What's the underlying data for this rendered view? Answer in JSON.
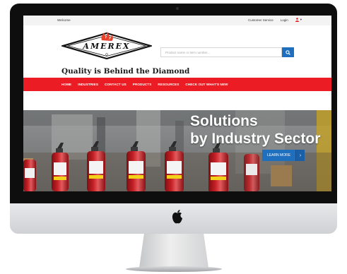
{
  "topbar": {
    "welcome": "Welcome",
    "customer_service": "Customer Service",
    "login": "Login",
    "user_caret": "▾"
  },
  "logo": {
    "text": "AMEREX"
  },
  "search": {
    "placeholder": "Product name or item number..."
  },
  "tagline": "Quality is Behind the Diamond",
  "nav": {
    "items": [
      "HOME",
      "INDUSTRIES",
      "CONTACT US",
      "PRODUCTS",
      "RESOURCES",
      "CHECK OUT WHAT'S NEW"
    ]
  },
  "hero": {
    "title_line1": "Solutions",
    "title_line2": "by Industry Sector",
    "button_label": "LEARN MORE",
    "button_arrow": "›"
  },
  "colors": {
    "nav_red": "#ec1c24",
    "button_blue": "#1f6fbf",
    "bezel": "#0e0e0f"
  }
}
